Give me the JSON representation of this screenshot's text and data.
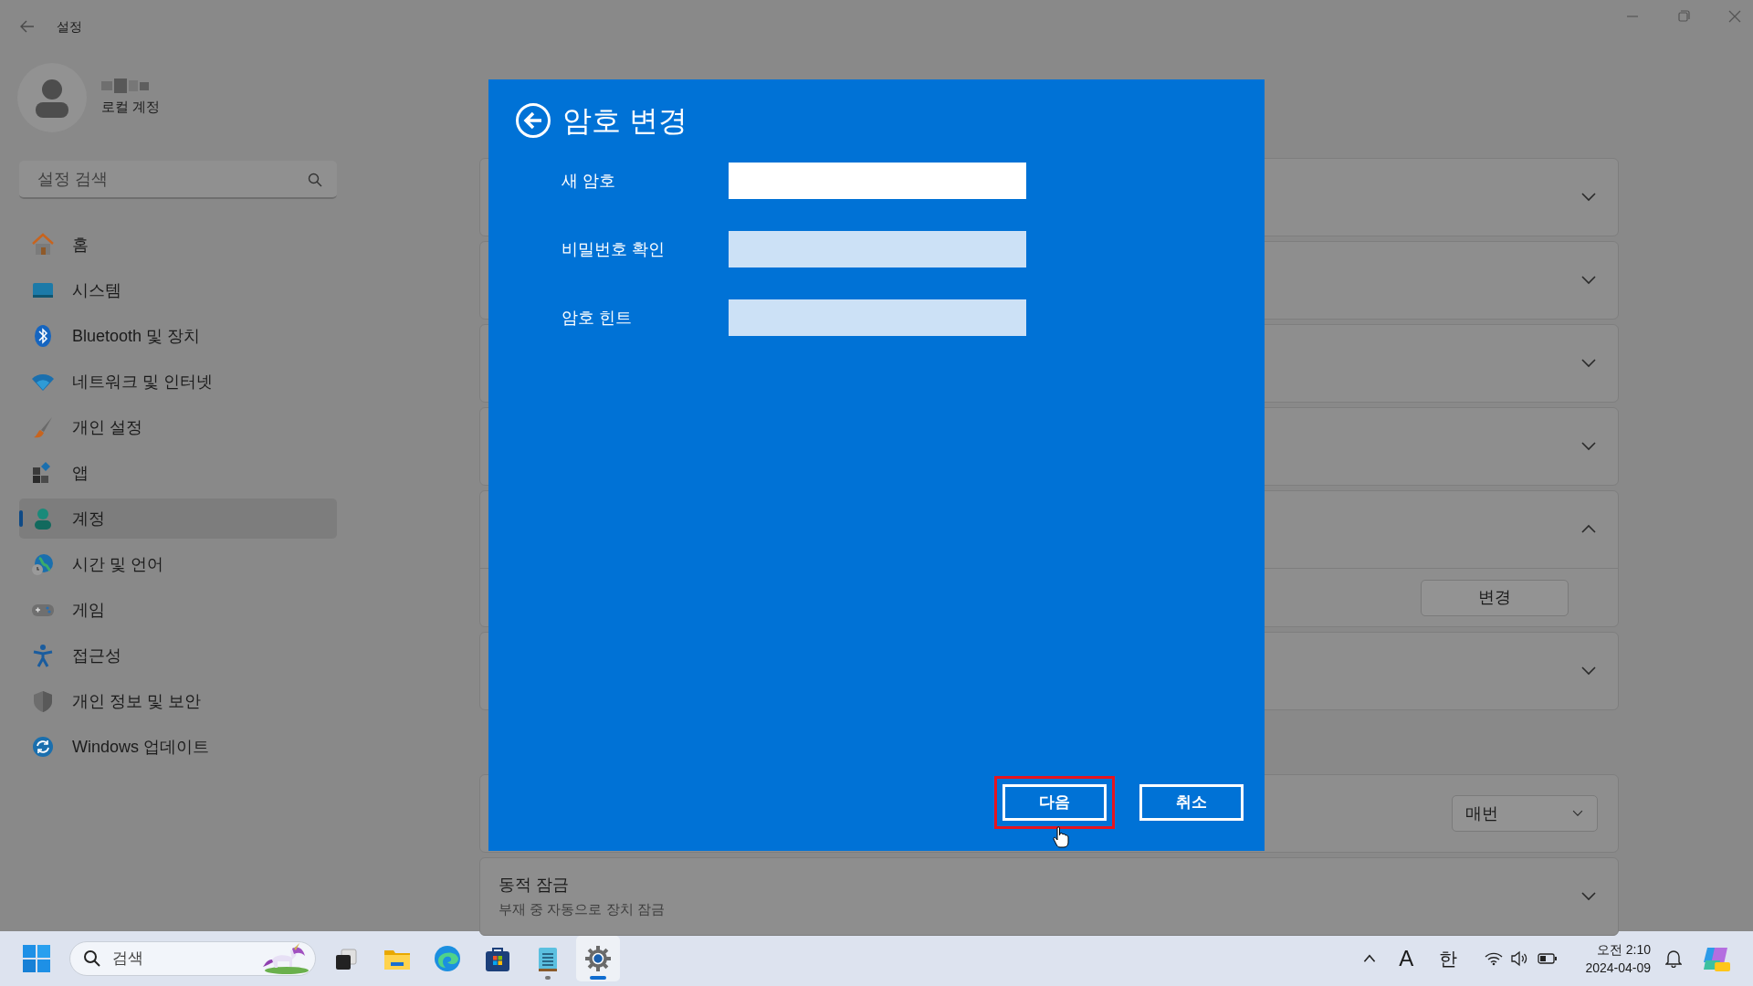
{
  "window": {
    "title": "설정"
  },
  "account": {
    "type": "로컬 계정"
  },
  "search": {
    "placeholder": "설정 검색"
  },
  "nav": [
    {
      "label": "홈",
      "kind": "home",
      "selected": false
    },
    {
      "label": "시스템",
      "kind": "system",
      "selected": false
    },
    {
      "label": "Bluetooth 및 장치",
      "kind": "bluetooth",
      "selected": false
    },
    {
      "label": "네트워크 및 인터넷",
      "kind": "network",
      "selected": false
    },
    {
      "label": "개인 설정",
      "kind": "brush",
      "selected": false
    },
    {
      "label": "앱",
      "kind": "apps",
      "selected": false
    },
    {
      "label": "계정",
      "kind": "person",
      "selected": true
    },
    {
      "label": "시간 및 언어",
      "kind": "globe",
      "selected": false
    },
    {
      "label": "게임",
      "kind": "gamepad",
      "selected": false
    },
    {
      "label": "접근성",
      "kind": "accessibility",
      "selected": false
    },
    {
      "label": "개인 정보 및 보안",
      "kind": "shield",
      "selected": false
    },
    {
      "label": "Windows 업데이트",
      "kind": "update",
      "selected": false
    }
  ],
  "sections": [
    {
      "cards": [
        {
          "kind": "expander",
          "expanded": false
        },
        {
          "kind": "expander",
          "expanded": false
        },
        {
          "kind": "expander",
          "expanded": false
        },
        {
          "kind": "expander",
          "expanded": false
        },
        {
          "kind": "expander",
          "expanded": true,
          "button": "변경"
        },
        {
          "kind": "expander",
          "expanded": false
        }
      ]
    },
    {
      "cards": [
        {
          "kind": "dropdown",
          "value": "매번"
        },
        {
          "kind": "expander",
          "expanded": false,
          "title": "동적 잠금",
          "description": "부재 중 자동으로 장치 잠금"
        }
      ]
    }
  ],
  "dialog": {
    "title": "암호 변경",
    "fields": [
      {
        "label": "새 암호",
        "focused": true
      },
      {
        "label": "비밀번호 확인",
        "focused": false
      },
      {
        "label": "암호 힌트",
        "focused": false
      }
    ],
    "buttons": [
      {
        "label": "다음",
        "highlighted": true
      },
      {
        "label": "취소",
        "highlighted": false
      }
    ]
  },
  "taskbar": {
    "search_placeholder": "검색",
    "apps": [
      {
        "kind": "taskview",
        "running": false,
        "selected": false
      },
      {
        "kind": "folder",
        "running": false,
        "selected": false
      },
      {
        "kind": "browser",
        "running": false,
        "selected": false
      },
      {
        "kind": "store",
        "running": false,
        "selected": false
      },
      {
        "kind": "notepad",
        "running": true,
        "selected": false
      },
      {
        "kind": "settings",
        "running": true,
        "selected": true
      }
    ],
    "ime_mode": "A",
    "ime_language": "한",
    "time": "오전 2:10",
    "date": "2024-04-09"
  }
}
